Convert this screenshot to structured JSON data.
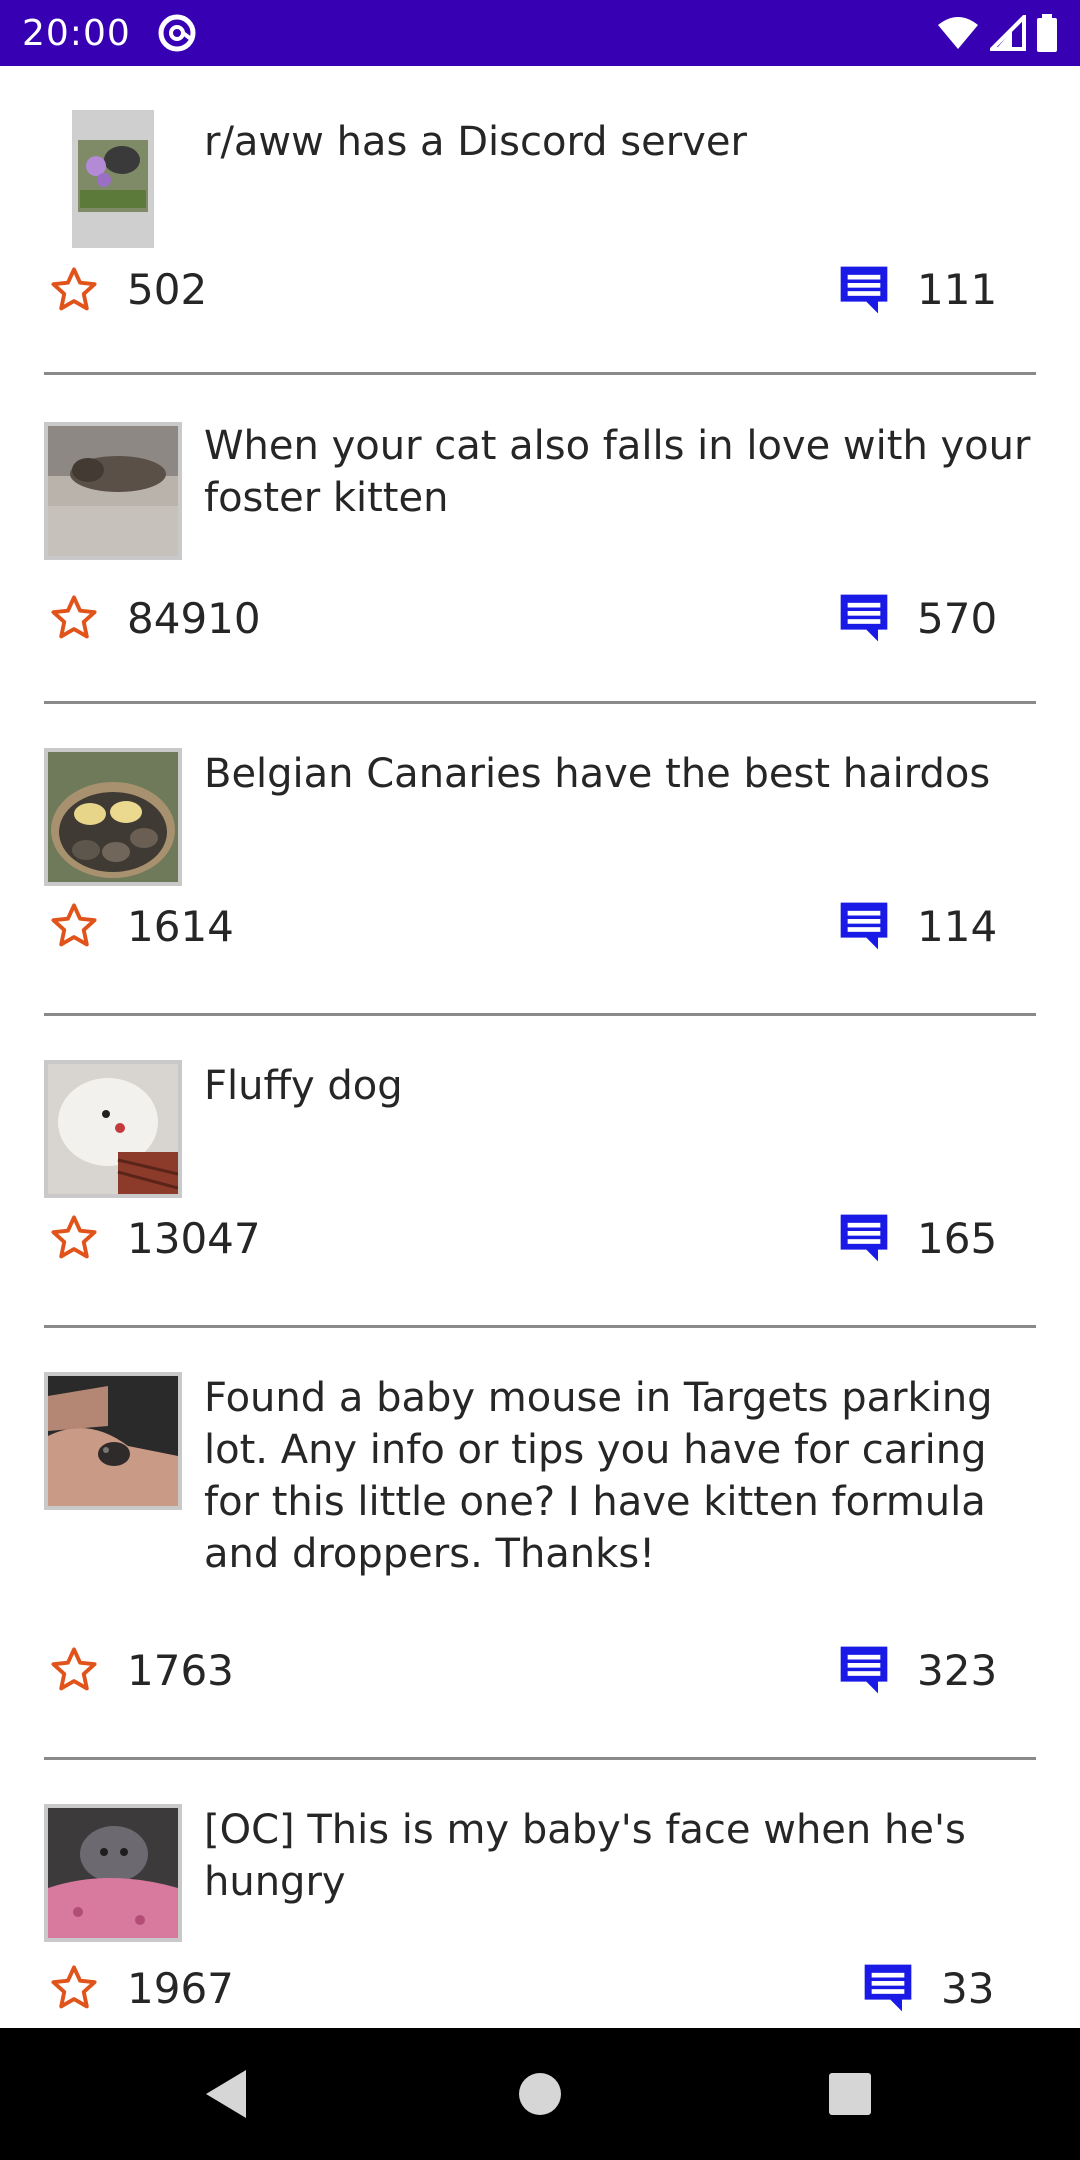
{
  "status_bar": {
    "time": "20:00",
    "app_icon": "at-sign-icon",
    "icons": [
      "wifi-icon",
      "cell-signal-icon",
      "battery-icon"
    ]
  },
  "colors": {
    "status_bar": "#3700b3",
    "star": "#e0531a",
    "comment": "#1a1ae6",
    "divider": "#8a8a8a",
    "nav_bar": "#000000"
  },
  "posts": [
    {
      "title": "r/aww has a Discord server",
      "score": "502",
      "comments": "111"
    },
    {
      "title": "When your cat also falls in love with your foster kitten",
      "score": "84910",
      "comments": "570"
    },
    {
      "title": "Belgian Canaries have the best hairdos",
      "score": "1614",
      "comments": "114"
    },
    {
      "title": "Fluffy dog",
      "score": "13047",
      "comments": "165"
    },
    {
      "title": "Found a baby mouse in Targets parking lot. Any info or tips you have for caring for this little one? I have kitten formula and droppers. Thanks!",
      "score": "1763",
      "comments": "323"
    },
    {
      "title": "[OC] This is my baby's face when he's hungry",
      "score": "1967",
      "comments": "33"
    }
  ],
  "nav_bar": {
    "icons": [
      "back-icon",
      "home-icon",
      "recents-icon"
    ]
  }
}
